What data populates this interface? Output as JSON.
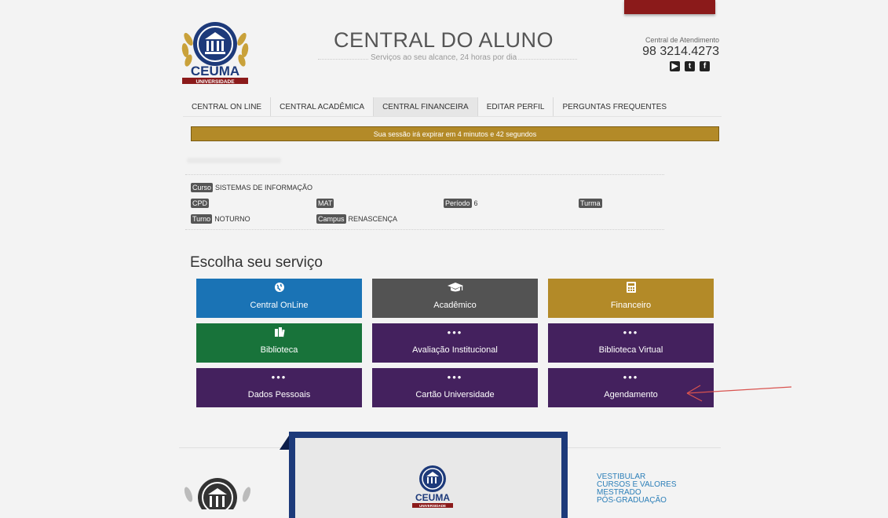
{
  "header": {
    "logo_text": "CEUMA",
    "logo_subtext": "UNIVERSIDADE",
    "title": "CENTRAL DO ALUNO",
    "subtitle": "Serviços ao seu alcance, 24 horas por dia",
    "contact_label": "Central de Atendimento",
    "contact_phone": "98 3214.4273",
    "social_icons": [
      "youtube-icon",
      "twitter-icon",
      "facebook-icon"
    ]
  },
  "nav": {
    "items": [
      {
        "label": "CENTRAL ON LINE"
      },
      {
        "label": "CENTRAL ACADÊMICA"
      },
      {
        "label": "CENTRAL FINANCEIRA"
      },
      {
        "label": "EDITAR PERFIL"
      },
      {
        "label": "PERGUNTAS FREQUENTES"
      }
    ]
  },
  "session": {
    "message": "Sua sessão irá expirar em 4 minutos e 42 segundos"
  },
  "student": {
    "curso_label": "Curso",
    "curso_value": "SISTEMAS DE INFORMAÇÃO",
    "cpd_label": "CPD",
    "mat_label": "MAT",
    "periodo_label": "Período",
    "periodo_value": "6",
    "turma_label": "Turma",
    "turno_label": "Turno",
    "turno_value": "NOTURNO",
    "campus_label": "Campus",
    "campus_value": "RENASCENÇA"
  },
  "services": {
    "title": "Escolha seu serviço",
    "tiles": [
      {
        "label": "Central OnLine",
        "icon": "globe-icon"
      },
      {
        "label": "Acadêmico",
        "icon": "graduation-cap-icon"
      },
      {
        "label": "Financeiro",
        "icon": "calculator-icon"
      },
      {
        "label": "Biblioteca",
        "icon": "books-icon"
      },
      {
        "label": "Avaliação Institucional",
        "icon": "ellipsis-icon"
      },
      {
        "label": "Biblioteca Virtual",
        "icon": "ellipsis-icon"
      },
      {
        "label": "Dados Pessoais",
        "icon": "ellipsis-icon"
      },
      {
        "label": "Cartão Universidade",
        "icon": "ellipsis-icon"
      },
      {
        "label": "Agendamento",
        "icon": "ellipsis-icon"
      }
    ]
  },
  "footer": {
    "links": [
      "VESTIBULAR",
      "CURSOS E VALORES",
      "MESTRADO",
      "PÓS-GRADUAÇÃO"
    ]
  },
  "colors": {
    "blue": "#1a73b5",
    "gray": "#535353",
    "gold": "#b38a28",
    "green": "#18733a",
    "purple": "#44215e",
    "navy": "#1d3a7a",
    "annotation": "#d9534f"
  }
}
